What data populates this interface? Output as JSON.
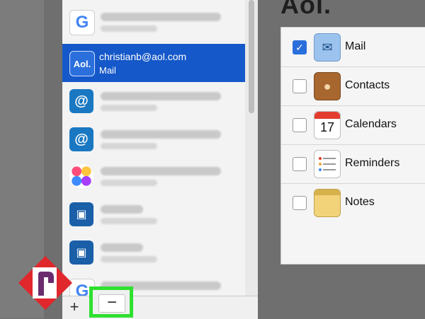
{
  "accounts": {
    "selected": {
      "icon_label": "Aol.",
      "email": "christianb@aol.com",
      "type": "Mail"
    },
    "items": [
      {
        "kind": "google"
      },
      {
        "kind": "aol",
        "selected": true
      },
      {
        "kind": "at"
      },
      {
        "kind": "at"
      },
      {
        "kind": "game-center"
      },
      {
        "kind": "exchange"
      },
      {
        "kind": "exchange"
      },
      {
        "kind": "google"
      }
    ]
  },
  "bottom_bar": {
    "add_label": "+",
    "remove_label": "−"
  },
  "right": {
    "title": "Aol.",
    "services": [
      {
        "label": "Mail",
        "checked": true,
        "icon": "mail-icon"
      },
      {
        "label": "Contacts",
        "checked": false,
        "icon": "contacts-icon"
      },
      {
        "label": "Calendars",
        "checked": false,
        "icon": "calendar-icon",
        "calendar_day": "17"
      },
      {
        "label": "Reminders",
        "checked": false,
        "icon": "reminders-icon"
      },
      {
        "label": "Notes",
        "checked": false,
        "icon": "notes-icon"
      }
    ]
  },
  "colors": {
    "selection_blue": "#1558c9",
    "highlight_green": "#2fe02f",
    "logo_red": "#e0272b",
    "logo_purple": "#6b2c6e"
  }
}
